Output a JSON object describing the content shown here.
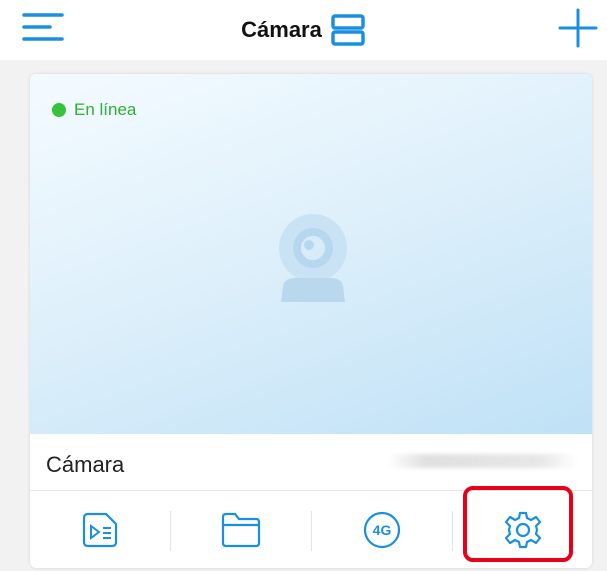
{
  "header": {
    "title": "Cámara",
    "menu_icon": "hamburger-menu-icon",
    "layout_icon": "split-layout-icon",
    "add_icon": "plus-icon"
  },
  "camera_card": {
    "status": "En línea",
    "name": "Cámara",
    "placeholder_icon": "camera-icon"
  },
  "toolbar": {
    "items": [
      {
        "icon": "playback-video-icon"
      },
      {
        "icon": "folder-icon"
      },
      {
        "icon": "4g-icon",
        "label": "4G"
      },
      {
        "icon": "gear-icon"
      }
    ]
  },
  "colors": {
    "accent": "#1a8fe0",
    "online": "#36c23a",
    "highlight": "#e8001a"
  }
}
